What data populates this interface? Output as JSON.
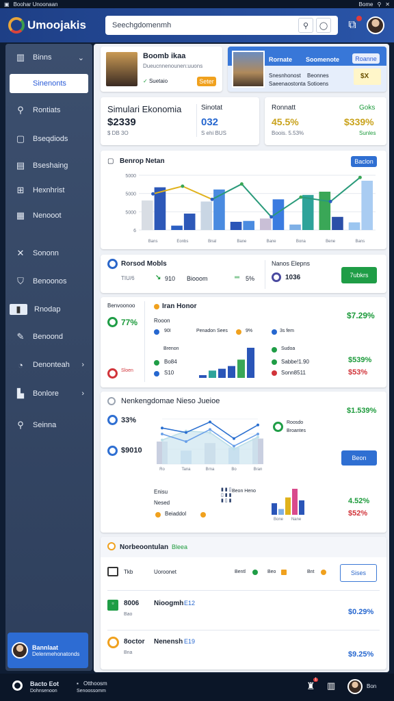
{
  "topstrip": {
    "title": "Boohar Unoonaan",
    "right_label": "Bome"
  },
  "header": {
    "brand": "Umoojakis",
    "search_placeholder": "Seechgdomenmh"
  },
  "sidebar": {
    "items": [
      {
        "label": "Binns",
        "icon": "grid-icon"
      },
      {
        "label": "Sinenonts",
        "icon": "users-icon"
      },
      {
        "label": "Rontiats",
        "icon": "search-icon"
      },
      {
        "label": "Bseqdiods",
        "icon": "document-icon"
      },
      {
        "label": "Bseshaing",
        "icon": "clipboard-icon"
      },
      {
        "label": "Hexnhrist",
        "icon": "table-icon"
      },
      {
        "label": "Nenooot",
        "icon": "layers-icon"
      },
      {
        "label": "Sononn",
        "icon": "tools-icon"
      },
      {
        "label": "Benoonos",
        "icon": "shield-icon"
      },
      {
        "label": "Rnodap",
        "icon": "folder-icon"
      },
      {
        "label": "Benoond",
        "icon": "edit-icon"
      },
      {
        "label": "Denonteah",
        "icon": "clock-icon"
      },
      {
        "label": "Bonlore",
        "icon": "chart-icon"
      },
      {
        "label": "Seinna",
        "icon": "search-icon"
      }
    ],
    "user": {
      "name": "Bannlaat",
      "sub": "Delenmehonatonds"
    }
  },
  "profile": {
    "title": "Boomb ikaa",
    "subtitle": "Dueucnnenounen:uuons",
    "status": "Suetaio",
    "action": "Seter"
  },
  "feature": {
    "title": "Rornate",
    "title2": "Soomenote",
    "line1": "Snesnhonost",
    "line1b": "Beonnes",
    "line2": "Saeenaostonta",
    "line2b": "Sotioens",
    "badge": "Roanne",
    "value": "$X"
  },
  "stats": {
    "s1": {
      "title": "Simulari Ekonomia",
      "value": "$2339",
      "sub": "$ DB 3O"
    },
    "s2": {
      "title": "Sinotat",
      "value": "032",
      "sub": "S ehi BUS"
    },
    "s3": {
      "title": "Ronnatt",
      "value": "45.5%",
      "sub": "Boois. 5.53%"
    },
    "s4": {
      "title": "Goks",
      "value": "$339%",
      "sub": "Sunles"
    }
  },
  "chart1": {
    "title": "Benrop Netan",
    "button": "Baclon"
  },
  "chart_data": [
    {
      "type": "bar",
      "categories": [
        "Bans",
        "Eonbs",
        "Bnal",
        "Bane",
        "Bane",
        "Bona",
        "Bene",
        "Bans"
      ],
      "series": [
        {
          "values": [
            2700,
            400,
            2600,
            750,
            1050,
            500,
            3500,
            700
          ]
        },
        {
          "values": [
            3900,
            1500,
            3700,
            830,
            2800,
            3200,
            1200,
            4500
          ]
        }
      ],
      "line": [
        3300,
        4000,
        2800,
        4200,
        1200,
        3000,
        2600,
        4800
      ],
      "yticks": [
        "5000",
        "5000",
        "5000",
        "6"
      ],
      "ylim": [
        0,
        5000
      ]
    },
    {
      "type": "bar",
      "values": [
        3,
        8,
        10,
        13,
        20,
        33
      ]
    },
    {
      "type": "area",
      "categories": [
        "Ro",
        "Tana",
        "Brna",
        "Bo",
        "Bran"
      ],
      "series": [
        {
          "values": [
            16,
            22,
            21,
            10,
            18
          ]
        },
        {
          "values": [
            24,
            21,
            28,
            17,
            26
          ]
        },
        {
          "values": [
            20,
            15,
            23,
            12,
            20
          ]
        }
      ],
      "bars": [
        15,
        9,
        14,
        11,
        17
      ],
      "ylim": [
        0,
        30
      ]
    },
    {
      "type": "bar",
      "categories": [
        "Bone",
        "Nane"
      ],
      "values": [
        4,
        2,
        6,
        9,
        5
      ]
    }
  ],
  "kpi": {
    "title": "Rorsod Mobls",
    "left_muted": "TIU/6",
    "v1": "910",
    "v1_label": "Biooom",
    "v2": "5%",
    "right_title": "Nanos Elepns",
    "v3": "1036",
    "button": "7ubkrs"
  },
  "mid": {
    "left_title": "Benvoonoo",
    "left_pct": "77%",
    "left_sub": "Sloen",
    "brand": "Iran Honor",
    "brand_sub": "Rooon",
    "r1a": "90I",
    "r1b": "Penadon  Sees",
    "r1c": "9%",
    "r1d": "3s fem",
    "right_top": "$7.29%",
    "e1": "Brenon",
    "e2": "Bo84",
    "e3": "S10",
    "e4": "Sudoa",
    "e5": "Sabbe!1.90",
    "e6": "Sonn8511",
    "right_g": "$539%",
    "right_r": "$53%"
  },
  "lower": {
    "title": "Nenkengdomae Nieso Jueioe",
    "pct": "33%",
    "val": "$9010",
    "right_top": "$1.539%",
    "r_label1": "Roosdo",
    "r_label2": "Broantes",
    "button": "Beon",
    "b_l1": "Enisu",
    "b_l2": "Nesed",
    "b_l3": "Beiaddol",
    "b_mid": "Beon Heno",
    "r_g": "4.52%",
    "r_r": "$52%"
  },
  "table": {
    "title": "Norbeoontulan",
    "tag": "Bleea",
    "head_icon_label": "Tkb",
    "head_col": "Uoroonet",
    "head_legend": [
      "Bentl",
      "Beo",
      "Bnt"
    ],
    "button": "Sises",
    "rows": [
      {
        "code": "8006",
        "sub": "Bao",
        "name": "Nioogmh",
        "tag": "E12",
        "value": "$0.29%"
      },
      {
        "code": "8octor",
        "sub": "Bna",
        "name": "Nenensh",
        "tag": "E19",
        "value": "$9.25%"
      }
    ]
  },
  "bottom": {
    "app": "Bacto Eot",
    "app_sub": "Dohnsenoon",
    "ctx": "Otthoosm",
    "ctx_sub": "Senoossomm",
    "user": "Bon",
    "badge": "1"
  },
  "colors": {
    "accent": "#2f6fd2",
    "green": "#1f9d46",
    "red": "#d1343a",
    "gold": "#c9a21b",
    "sidebar": "#34476a"
  }
}
